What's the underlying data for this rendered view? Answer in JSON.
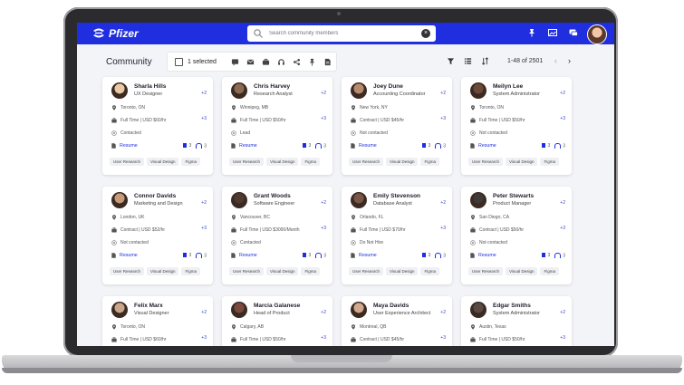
{
  "app": {
    "brand": "Pfizer"
  },
  "search": {
    "placeholder": "Search community members"
  },
  "toolbar": {
    "title": "Community",
    "selected": "1 selected",
    "pagination": "1-48 of 2501",
    "prev": "‹",
    "next": "›"
  },
  "icons": {
    "topbar": [
      "pin-icon",
      "image-icon",
      "chat-icon"
    ],
    "selection_actions": [
      "message-icon",
      "mail-icon",
      "briefcase-icon",
      "headset-icon",
      "share-icon",
      "pin-icon",
      "document-icon"
    ],
    "view_tools": [
      "filter-icon",
      "list-view-icon",
      "sort-icon"
    ]
  },
  "colors": {
    "brand": "#1f2fe0",
    "badge": "#3342c8"
  },
  "cards": [
    {
      "name": "Sharla Hills",
      "role": "UX Designer",
      "role_more": "+2",
      "location": "Toronto, ON",
      "employment": "Full Time | USD $60/hr",
      "emp_more": "+3",
      "status": "Contacted",
      "resume": "Resume",
      "c1": "3",
      "c2": "3",
      "tags": [
        "User Research",
        "Visual Design",
        "Figma"
      ]
    },
    {
      "name": "Chris Harvey",
      "role": "Research Analyst",
      "role_more": "+2",
      "location": "Winnipeg, MB",
      "employment": "Full Time | USD $50/hr",
      "emp_more": "+3",
      "status": "Lead",
      "resume": "Resume",
      "c1": "3",
      "c2": "3",
      "tags": [
        "User Research",
        "Visual Design",
        "Figma"
      ]
    },
    {
      "name": "Joey Dune",
      "role": "Accounting Coordinator",
      "role_more": "+2",
      "location": "New York, NY",
      "employment": "Contract | USD $45/hr",
      "emp_more": "+3",
      "status": "Not contacted",
      "resume": "Resume",
      "c1": "3",
      "c2": "3",
      "tags": [
        "User Research",
        "Visual Design",
        "Figma"
      ]
    },
    {
      "name": "Meilyn Lee",
      "role": "System Administrator",
      "role_more": "+2",
      "location": "Toronto, ON",
      "employment": "Full Time | USD $50/hr",
      "emp_more": "+3",
      "status": "Not contacted",
      "resume": "Resume",
      "c1": "3",
      "c2": "3",
      "tags": [
        "User Research",
        "Visual Design",
        "Figma"
      ]
    },
    {
      "name": "Connor Davids",
      "role": "Marketing and Design",
      "role_more": "+2",
      "location": "London, UK",
      "employment": "Contract | USD $52/hr",
      "emp_more": "+3",
      "status": "Not contacted",
      "resume": "Resume",
      "c1": "3",
      "c2": "3",
      "tags": [
        "User Research",
        "Visual Design",
        "Figma"
      ]
    },
    {
      "name": "Grant Woods",
      "role": "Software Engineer",
      "role_more": "+2",
      "location": "Vancouver, BC",
      "employment": "Full Time | USD $3000/Month",
      "emp_more": "+3",
      "status": "Contacted",
      "resume": "Resume",
      "c1": "3",
      "c2": "3",
      "tags": [
        "User Research",
        "Visual Design",
        "Figma"
      ]
    },
    {
      "name": "Emily Stevenson",
      "role": "Database Analyst",
      "role_more": "+2",
      "location": "Orlando, FL",
      "employment": "Full Time | USD $70/hr",
      "emp_more": "+3",
      "status": "Do Not Hire",
      "resume": "Resume",
      "c1": "3",
      "c2": "3",
      "tags": [
        "User Research",
        "Visual Design",
        "Figma"
      ]
    },
    {
      "name": "Peter Stewarts",
      "role": "Product Manager",
      "role_more": "+2",
      "location": "San Diego, CA",
      "employment": "Contract | USD $50/hr",
      "emp_more": "+3",
      "status": "Not contacted",
      "resume": "Resume",
      "c1": "3",
      "c2": "3",
      "tags": [
        "User Research",
        "Visual Design",
        "Figma"
      ]
    },
    {
      "name": "Felix Marx",
      "role": "Visual Designer",
      "role_more": "+2",
      "location": "Toronto, ON",
      "employment": "Full Time | USD $60/hr",
      "emp_more": "+3",
      "status": "",
      "resume": "",
      "c1": "",
      "c2": "",
      "tags": []
    },
    {
      "name": "Marcia Galanese",
      "role": "Head of Product",
      "role_more": "+2",
      "location": "Calgary, AB",
      "employment": "Full Time | USD $50/hr",
      "emp_more": "+3",
      "status": "",
      "resume": "",
      "c1": "",
      "c2": "",
      "tags": []
    },
    {
      "name": "Maya Davids",
      "role": "User Experience Architect",
      "role_more": "+2",
      "location": "Montreal, QB",
      "employment": "Contract | USD $45/hr",
      "emp_more": "+3",
      "status": "",
      "resume": "",
      "c1": "",
      "c2": "",
      "tags": []
    },
    {
      "name": "Edgar Smiths",
      "role": "System Administrator",
      "role_more": "+2",
      "location": "Austin, Texas",
      "employment": "Full Time | USD $50/hr",
      "emp_more": "+3",
      "status": "",
      "resume": "",
      "c1": "",
      "c2": "",
      "tags": []
    }
  ]
}
